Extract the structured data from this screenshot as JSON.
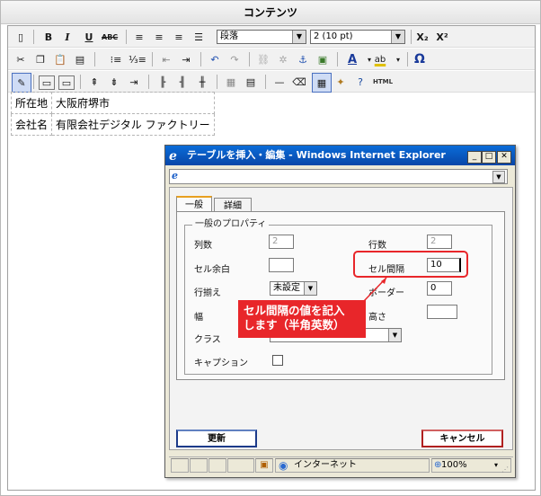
{
  "panel": {
    "title": "コンテンツ"
  },
  "toolbar": {
    "bold": "B",
    "italic": "I",
    "underline": "U",
    "strike": "ABC",
    "format_value": "段落",
    "fontsize_value": "2 (10 pt)",
    "sub": "X₂",
    "sup": "X²",
    "html": "HTML",
    "omega": "Ω",
    "font_color": "A",
    "highlight": "ab"
  },
  "content_table": {
    "rows": [
      [
        "所在地",
        "大阪府堺市"
      ],
      [
        "会社名",
        "有限会社デジタル ファクトリー"
      ]
    ]
  },
  "dialog": {
    "title": "テーブルを挿入・編集 - Windows Internet Explorer",
    "tabs": [
      "一般",
      "詳細"
    ],
    "legend": "一般のプロパティ",
    "labels": {
      "cols": "列数",
      "rows": "行数",
      "cellpadding": "セル余白",
      "cellspacing": "セル間隔",
      "align": "行揃え",
      "border": "ボーダー",
      "width": "幅",
      "height": "高さ",
      "class": "クラス",
      "caption": "キャプション"
    },
    "values": {
      "cols": "2",
      "rows": "2",
      "cellpadding": "",
      "cellspacing": "10",
      "align": "未設定",
      "border": "0",
      "width": "",
      "height": "",
      "class": "未設定"
    },
    "buttons": {
      "update": "更新",
      "cancel": "キャンセル"
    },
    "status": {
      "zone": "インターネット",
      "zoom": "100%"
    }
  },
  "annotation": {
    "line1": "セル間隔の値を記入",
    "line2": "します（半角英数）"
  },
  "colors": {
    "accent_red": "#e8262a",
    "ie_title": "#0a5ac8"
  }
}
